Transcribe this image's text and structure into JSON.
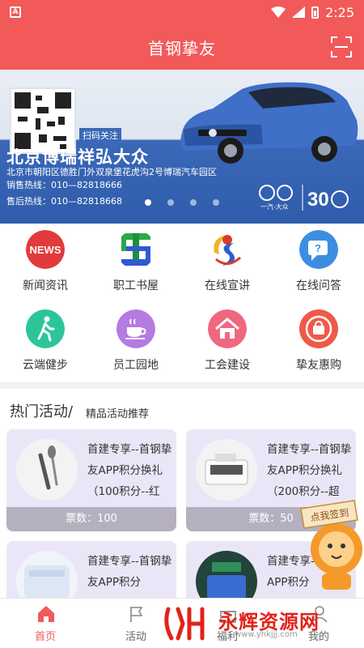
{
  "statusbar": {
    "time": "2:25",
    "left_icon": "A"
  },
  "header": {
    "title": "首钢挚友",
    "scan_icon": "scan-icon"
  },
  "banner": {
    "scan_hint": "扫码关注",
    "brand": "北京博瑞祥弘大众",
    "address": "北京市朝阳区德胜门外双泉堡花虎沟2号博瑞汽车园区",
    "sales_line": "销售热线：010—82818666",
    "service_line": "售后热线：010—82818668",
    "logo_text": "一汽-大众",
    "dots": 4,
    "active_dot": 0
  },
  "grid": [
    {
      "label": "新闻资讯",
      "icon": "news-icon",
      "color": "#e23a3a"
    },
    {
      "label": "职工书屋",
      "icon": "bookhouse-icon",
      "color": "#1f8e3a"
    },
    {
      "label": "在线宣讲",
      "icon": "lecture-icon",
      "color": "#d93d2b"
    },
    {
      "label": "在线问答",
      "icon": "qa-icon",
      "color": "#3c8ee0"
    },
    {
      "label": "云端健步",
      "icon": "walk-icon",
      "color": "#2cc59a"
    },
    {
      "label": "员工园地",
      "icon": "coffee-icon",
      "color": "#b57be0"
    },
    {
      "label": "工会建设",
      "icon": "house-icon",
      "color": "#f0687f"
    },
    {
      "label": "挚友惠购",
      "icon": "shop-icon",
      "color": "#ef5a48"
    }
  ],
  "hot": {
    "title": "热门活动/",
    "subtitle": "精品活动推荐",
    "cards": [
      {
        "text": "首建专享--首钢挚友APP积分换礼（100积分--红",
        "tickets": "票数：100"
      },
      {
        "text": "首建专享--首钢挚友APP积分换礼（200积分--超",
        "tickets": "票数：50"
      },
      {
        "text": "首建专享--首钢挚友APP积分",
        "tickets": ""
      },
      {
        "text": "首建专享--首挚友APP积分",
        "tickets": ""
      }
    ]
  },
  "signin": {
    "label": "点我签到"
  },
  "bottomnav": [
    {
      "label": "首页",
      "icon": "home-icon"
    },
    {
      "label": "活动",
      "icon": "flag-icon"
    },
    {
      "label": "福利",
      "icon": "gift-icon"
    },
    {
      "label": "我的",
      "icon": "user-icon"
    }
  ],
  "watermark": {
    "text": "永辉资源网",
    "url": "www.yhkjjj.com"
  },
  "colors": {
    "primary": "#f25a5a",
    "card_bg": "#ebe6f7",
    "ticket_bar": "#b5b0bf"
  }
}
